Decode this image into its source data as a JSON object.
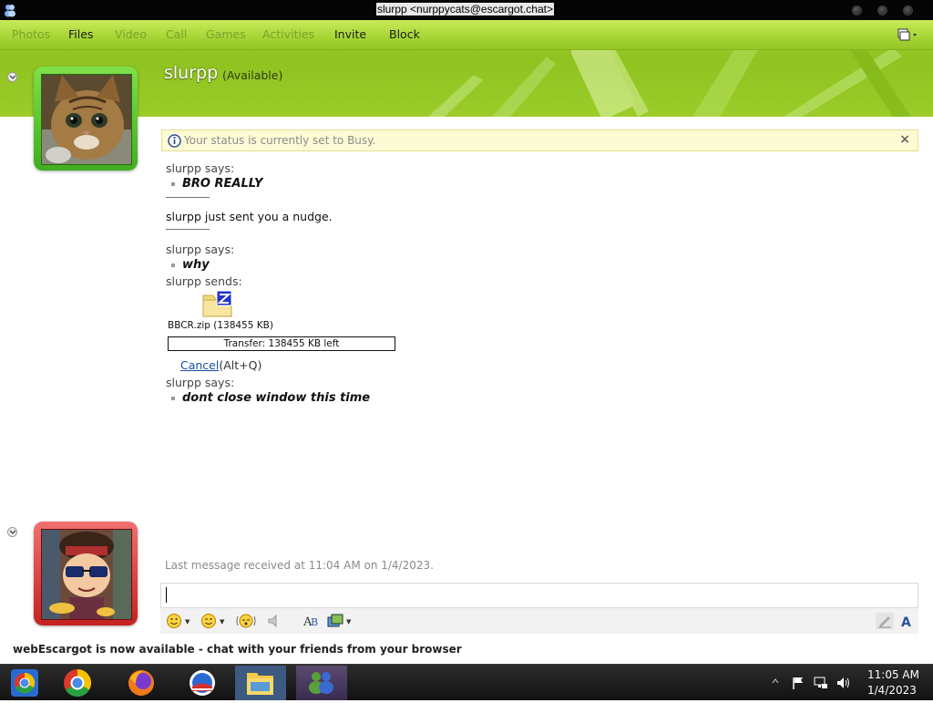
{
  "window": {
    "title": "slurpp <nurppycats@escargot.chat>"
  },
  "menu": {
    "items": [
      {
        "label": "Photos",
        "enabled": false
      },
      {
        "label": "Files",
        "enabled": true
      },
      {
        "label": "Video",
        "enabled": false
      },
      {
        "label": "Call",
        "enabled": false
      },
      {
        "label": "Games",
        "enabled": false
      },
      {
        "label": "Activities",
        "enabled": false
      },
      {
        "label": "Invite",
        "enabled": true
      },
      {
        "label": "Block",
        "enabled": true
      }
    ]
  },
  "contact": {
    "name": "slurpp",
    "status": "(Available)"
  },
  "infobar": {
    "message": "Your status is currently set to Busy.",
    "close": "×"
  },
  "conversation": {
    "says1": "slurpp says:",
    "msg1": "BRO REALLY",
    "nudge": "slurpp just sent you a nudge.",
    "says2": "slurpp says:",
    "msg2": "why",
    "sends": "slurpp sends:",
    "file_name": "BBCR.zip (138455 KB)",
    "transfer": "Transfer: 138455 KB left",
    "cancel_link": "Cancel",
    "cancel_shortcut": "(Alt+Q)",
    "says3": "slurpp says:",
    "msg3": "dont close window this time"
  },
  "footer": {
    "last_message": "Last message received at 11:04 AM on 1/4/2023.",
    "promo": "webEscargot is now available - chat with your friends from your browser"
  },
  "taskbar": {
    "time": "11:05 AM",
    "date": "1/4/2023"
  },
  "colors": {
    "accent": "#9bcc2a",
    "menu_disabled": "#7aa12a",
    "link": "#1a4fa0",
    "contact_frame": "#3fae1e",
    "user_frame": "#c62020"
  }
}
